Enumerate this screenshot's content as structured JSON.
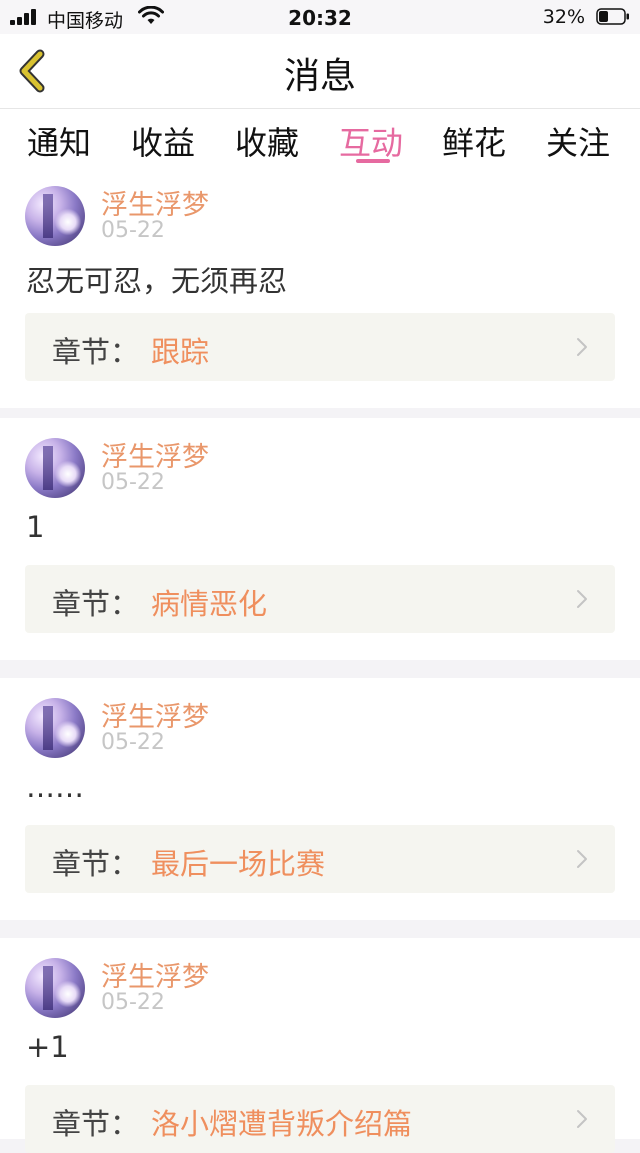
{
  "status_bar": {
    "carrier": "中国移动",
    "time": "20:32",
    "battery": "32%"
  },
  "nav": {
    "title": "消息",
    "back_icon": "chevron-left-icon"
  },
  "tabs": [
    {
      "label": "通知"
    },
    {
      "label": "收益"
    },
    {
      "label": "收藏"
    },
    {
      "label": "互动",
      "active": true
    },
    {
      "label": "鲜花"
    },
    {
      "label": "关注"
    }
  ],
  "messages": [
    {
      "user": "浮生浮梦",
      "date": "05-22",
      "text": "忍无可忍，无须再忍",
      "chapter_label": "章节：",
      "chapter": "跟踪"
    },
    {
      "user": "浮生浮梦",
      "date": "05-22",
      "text": "1",
      "chapter_label": "章节：",
      "chapter": "病情恶化"
    },
    {
      "user": "浮生浮梦",
      "date": "05-22",
      "text": "……",
      "chapter_label": "章节：",
      "chapter": "最后一场比赛"
    },
    {
      "user": "浮生浮梦",
      "date": "05-22",
      "text": "+1",
      "chapter_label": "章节：",
      "chapter": "洛小熠遭背叛介绍篇"
    }
  ],
  "colors": {
    "accent": "#e66aa0",
    "username": "#e9976b",
    "chapter": "#ef8f5e",
    "back_icon": "#d9c230"
  }
}
